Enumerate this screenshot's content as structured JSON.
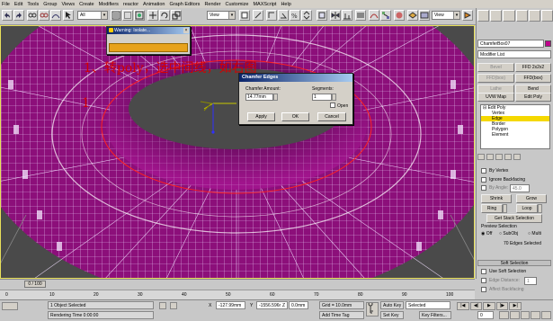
{
  "menu": [
    "File",
    "Edit",
    "Tools",
    "Group",
    "Views",
    "Create",
    "Modifiers",
    "reactor",
    "Animation",
    "Graph Editors",
    "Render",
    "Customize",
    "MAXScript",
    "Help"
  ],
  "toolbar": {
    "filter": "All",
    "viewcombo": "View",
    "viewcombo2": "View"
  },
  "overlay": {
    "line1": "1、转poly，选中间线，如右图",
    "line2": "1"
  },
  "warning": {
    "title": "Warning: Isolate..."
  },
  "chamfer": {
    "title": "Chamfer Edges",
    "amount_label": "Chamfer Amount:",
    "amount_value": "14.77mm",
    "segments_label": "Segments:",
    "segments_value": "1",
    "open_label": "Open",
    "apply": "Apply",
    "ok": "OK",
    "cancel": "Cancel"
  },
  "panel": {
    "object_name": "ChamferBox07",
    "modifier_list": "Modifier List",
    "buttons": [
      "Bevel",
      "FFD 2x2x2",
      "FFD(box)",
      "FFD(box)",
      "Lathe",
      "Bend",
      "UVW Map",
      "Edit Poly"
    ],
    "stack": [
      {
        "label": "Edit Poly"
      },
      {
        "label": "Vertex"
      },
      {
        "label": "Edge"
      },
      {
        "label": "Border"
      },
      {
        "label": "Polygon"
      },
      {
        "label": "Element"
      }
    ],
    "selection": {
      "by_vertex": "By Vertex",
      "ignore_backfacing": "Ignore Backfacing",
      "by_angle": "By Angle:",
      "angle": "45.0",
      "shrink": "Shrink",
      "grow": "Grow",
      "ring": "Ring",
      "loop": "Loop",
      "get_stack": "Get Stack Selection",
      "preview": "Preview Selection",
      "off": "Off",
      "subobj": "SubObj",
      "multi": "Multi",
      "count": "70 Edges Selected"
    },
    "soft": {
      "header": "Soft Selection",
      "use": "Use Soft Selection",
      "edge_dist": "Edge Distance:",
      "edge_dist_val": "1",
      "affect_back": "Affect Backfacing"
    }
  },
  "timeline": {
    "slider": "0 / 100",
    "ticks": [
      "0",
      "10",
      "20",
      "30",
      "40",
      "50",
      "60",
      "70",
      "80",
      "90",
      "100"
    ]
  },
  "status": {
    "selected": "1 Object Selected",
    "render": "Rendering Time  0:00:00",
    "x": "-127.99mm",
    "y": "-1556.596r",
    "z": "0.0mm",
    "grid": "Grid = 10.0mm",
    "addtime": "Add Time Tag",
    "autokey": "Auto Key",
    "setkey": "Set Key",
    "selected_combo": "Selected",
    "keyfilters": "Key Filters...",
    "frame": "0"
  },
  "colors": {
    "wire": "#e8c8ff",
    "mesh": "#8c0f7a",
    "accent": "#f5d800"
  }
}
